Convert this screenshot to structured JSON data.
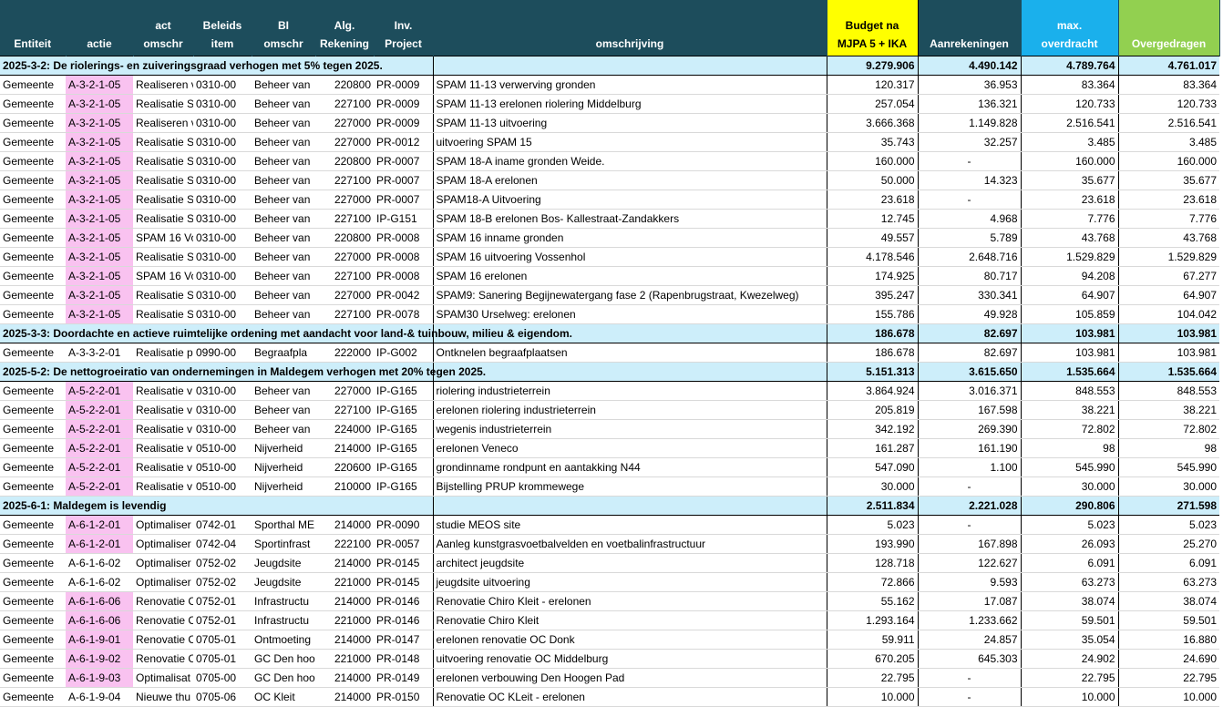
{
  "headers": {
    "entiteit": [
      "",
      "Entiteit"
    ],
    "actie": [
      "",
      "actie"
    ],
    "act_omschr": [
      "act",
      "omschr"
    ],
    "beleids_item": [
      "Beleids",
      "item"
    ],
    "bi_omschr": [
      "BI",
      "omschr"
    ],
    "alg_rekening": [
      "Alg.",
      "Rekening"
    ],
    "inv_project": [
      "Inv.",
      "Project"
    ],
    "omschrijving": [
      "",
      "omschrijving"
    ],
    "budget": [
      "Budget na",
      "MJPA 5 + IKA"
    ],
    "aanrekeningen": [
      "",
      "Aanrekeningen"
    ],
    "max_overdracht": [
      "max.",
      "overdracht"
    ],
    "overgedragen": [
      "",
      "Overgedragen"
    ]
  },
  "groups": [
    {
      "title": "2025-3-2: De riolerings- en zuiveringsgraad verhogen met 5% tegen 2025.",
      "budget": "9.279.906",
      "aanrekeningen": "4.490.142",
      "max_overdracht": "4.789.764",
      "overgedragen": "4.761.017",
      "rows": [
        {
          "entiteit": "Gemeente",
          "actie": "A-3-2-1-05",
          "pink": true,
          "act_omschr": "Realiseren v",
          "beleids_item": "0310-00",
          "bi_omschr": "Beheer van",
          "alg_rekening": "220800",
          "inv_project": "PR-0009",
          "omschrijving": "SPAM 11-13 verwerving gronden",
          "budget": "120.317",
          "aanrekeningen": "36.953",
          "max_overdracht": "83.364",
          "overgedragen": "83.364"
        },
        {
          "entiteit": "Gemeente",
          "actie": "A-3-2-1-05",
          "pink": true,
          "act_omschr": "Realisatie S",
          "beleids_item": "0310-00",
          "bi_omschr": "Beheer van",
          "alg_rekening": "227100",
          "inv_project": "PR-0009",
          "omschrijving": "SPAM 11-13 erelonen riolering Middelburg",
          "budget": "257.054",
          "aanrekeningen": "136.321",
          "max_overdracht": "120.733",
          "overgedragen": "120.733"
        },
        {
          "entiteit": "Gemeente",
          "actie": "A-3-2-1-05",
          "pink": true,
          "act_omschr": "Realiseren v",
          "beleids_item": "0310-00",
          "bi_omschr": "Beheer van",
          "alg_rekening": "227000",
          "inv_project": "PR-0009",
          "omschrijving": "SPAM 11-13 uitvoering",
          "budget": "3.666.368",
          "aanrekeningen": "1.149.828",
          "max_overdracht": "2.516.541",
          "overgedragen": "2.516.541"
        },
        {
          "entiteit": "Gemeente",
          "actie": "A-3-2-1-05",
          "pink": true,
          "act_omschr": "Realisatie S",
          "beleids_item": "0310-00",
          "bi_omschr": "Beheer van",
          "alg_rekening": "227000",
          "inv_project": "PR-0012",
          "omschrijving": "uitvoering SPAM 15",
          "budget": "35.743",
          "aanrekeningen": "32.257",
          "max_overdracht": "3.485",
          "overgedragen": "3.485"
        },
        {
          "entiteit": "Gemeente",
          "actie": "A-3-2-1-05",
          "pink": true,
          "act_omschr": "Realisatie S",
          "beleids_item": "0310-00",
          "bi_omschr": "Beheer van",
          "alg_rekening": "220800",
          "inv_project": "PR-0007",
          "omschrijving": "SPAM 18-A iname gronden Weide.",
          "budget": "160.000",
          "aanrekeningen": "-",
          "max_overdracht": "160.000",
          "overgedragen": "160.000"
        },
        {
          "entiteit": "Gemeente",
          "actie": "A-3-2-1-05",
          "pink": true,
          "act_omschr": "Realisatie S",
          "beleids_item": "0310-00",
          "bi_omschr": "Beheer van",
          "alg_rekening": "227100",
          "inv_project": "PR-0007",
          "omschrijving": "SPAM 18-A erelonen",
          "budget": "50.000",
          "aanrekeningen": "14.323",
          "max_overdracht": "35.677",
          "overgedragen": "35.677"
        },
        {
          "entiteit": "Gemeente",
          "actie": "A-3-2-1-05",
          "pink": true,
          "act_omschr": "Realisatie S",
          "beleids_item": "0310-00",
          "bi_omschr": "Beheer van",
          "alg_rekening": "227000",
          "inv_project": "PR-0007",
          "omschrijving": "SPAM18-A Uitvoering",
          "budget": "23.618",
          "aanrekeningen": "-",
          "max_overdracht": "23.618",
          "overgedragen": "23.618"
        },
        {
          "entiteit": "Gemeente",
          "actie": "A-3-2-1-05",
          "pink": true,
          "act_omschr": "Realisatie S",
          "beleids_item": "0310-00",
          "bi_omschr": "Beheer van",
          "alg_rekening": "227100",
          "inv_project": "IP-G151",
          "omschrijving": "SPAM 18-B erelonen  Bos- Kallestraat-Zandakkers",
          "budget": "12.745",
          "aanrekeningen": "4.968",
          "max_overdracht": "7.776",
          "overgedragen": "7.776"
        },
        {
          "entiteit": "Gemeente",
          "actie": "A-3-2-1-05",
          "pink": true,
          "act_omschr": "SPAM 16 Vo",
          "beleids_item": "0310-00",
          "bi_omschr": "Beheer van",
          "alg_rekening": "220800",
          "inv_project": "PR-0008",
          "omschrijving": "SPAM 16 inname gronden",
          "budget": "49.557",
          "aanrekeningen": "5.789",
          "max_overdracht": "43.768",
          "overgedragen": "43.768"
        },
        {
          "entiteit": "Gemeente",
          "actie": "A-3-2-1-05",
          "pink": true,
          "act_omschr": "Realisatie S",
          "beleids_item": "0310-00",
          "bi_omschr": "Beheer van",
          "alg_rekening": "227000",
          "inv_project": "PR-0008",
          "omschrijving": "SPAM 16 uitvoering Vossenhol",
          "budget": "4.178.546",
          "aanrekeningen": "2.648.716",
          "max_overdracht": "1.529.829",
          "overgedragen": "1.529.829"
        },
        {
          "entiteit": "Gemeente",
          "actie": "A-3-2-1-05",
          "pink": true,
          "act_omschr": "SPAM 16 Vo",
          "beleids_item": "0310-00",
          "bi_omschr": "Beheer van",
          "alg_rekening": "227100",
          "inv_project": "PR-0008",
          "omschrijving": "SPAM 16 erelonen",
          "budget": "174.925",
          "aanrekeningen": "80.717",
          "max_overdracht": "94.208",
          "overgedragen": "67.277"
        },
        {
          "entiteit": "Gemeente",
          "actie": "A-3-2-1-05",
          "pink": true,
          "act_omschr": "Realisatie S",
          "beleids_item": "0310-00",
          "bi_omschr": "Beheer van",
          "alg_rekening": "227000",
          "inv_project": "PR-0042",
          "omschrijving": "SPAM9: Sanering Begijnewatergang fase 2 (Rapenbrugstraat, Kwezelweg)",
          "budget": "395.247",
          "aanrekeningen": "330.341",
          "max_overdracht": "64.907",
          "overgedragen": "64.907"
        },
        {
          "entiteit": "Gemeente",
          "actie": "A-3-2-1-05",
          "pink": true,
          "act_omschr": "Realisatie S",
          "beleids_item": "0310-00",
          "bi_omschr": "Beheer van",
          "alg_rekening": "227100",
          "inv_project": "PR-0078",
          "omschrijving": "SPAM30 Urselweg: erelonen",
          "budget": "155.786",
          "aanrekeningen": "49.928",
          "max_overdracht": "105.859",
          "overgedragen": "104.042"
        }
      ]
    },
    {
      "title": "2025-3-3: Doordachte en actieve ruimtelijke ordening met aandacht voor land-& tuinbouw, milieu & eigendom.",
      "budget": "186.678",
      "aanrekeningen": "82.697",
      "max_overdracht": "103.981",
      "overgedragen": "103.981",
      "rows": [
        {
          "entiteit": "Gemeente",
          "actie": "A-3-3-2-01",
          "pink": false,
          "act_omschr": "Realisatie p",
          "beleids_item": "0990-00",
          "bi_omschr": "Begraafpla",
          "alg_rekening": "222000",
          "inv_project": "IP-G002",
          "omschrijving": "Ontknelen begraafplaatsen",
          "budget": "186.678",
          "aanrekeningen": "82.697",
          "max_overdracht": "103.981",
          "overgedragen": "103.981"
        }
      ]
    },
    {
      "title": "2025-5-2: De nettogroeiratio van ondernemingen in Maldegem verhogen met 20% tegen 2025.",
      "budget": "5.151.313",
      "aanrekeningen": "3.615.650",
      "max_overdracht": "1.535.664",
      "overgedragen": "1.535.664",
      "rows": [
        {
          "entiteit": "Gemeente",
          "actie": "A-5-2-2-01",
          "pink": true,
          "act_omschr": "Realisatie v",
          "beleids_item": "0310-00",
          "bi_omschr": "Beheer van",
          "alg_rekening": "227000",
          "inv_project": "IP-G165",
          "omschrijving": "riolering industrieterrein",
          "budget": "3.864.924",
          "aanrekeningen": "3.016.371",
          "max_overdracht": "848.553",
          "overgedragen": "848.553"
        },
        {
          "entiteit": "Gemeente",
          "actie": "A-5-2-2-01",
          "pink": true,
          "act_omschr": "Realisatie v",
          "beleids_item": "0310-00",
          "bi_omschr": "Beheer van",
          "alg_rekening": "227100",
          "inv_project": "IP-G165",
          "omschrijving": "erelonen riolering industrieterrein",
          "budget": "205.819",
          "aanrekeningen": "167.598",
          "max_overdracht": "38.221",
          "overgedragen": "38.221"
        },
        {
          "entiteit": "Gemeente",
          "actie": "A-5-2-2-01",
          "pink": true,
          "act_omschr": "Realisatie v",
          "beleids_item": "0310-00",
          "bi_omschr": "Beheer van",
          "alg_rekening": "224000",
          "inv_project": "IP-G165",
          "omschrijving": "wegenis industrieterrein",
          "budget": "342.192",
          "aanrekeningen": "269.390",
          "max_overdracht": "72.802",
          "overgedragen": "72.802"
        },
        {
          "entiteit": "Gemeente",
          "actie": "A-5-2-2-01",
          "pink": true,
          "act_omschr": "Realisatie v",
          "beleids_item": "0510-00",
          "bi_omschr": "Nijverheid",
          "alg_rekening": "214000",
          "inv_project": "IP-G165",
          "omschrijving": "erelonen Veneco",
          "budget": "161.287",
          "aanrekeningen": "161.190",
          "max_overdracht": "98",
          "overgedragen": "98"
        },
        {
          "entiteit": "Gemeente",
          "actie": "A-5-2-2-01",
          "pink": true,
          "act_omschr": "Realisatie v",
          "beleids_item": "0510-00",
          "bi_omschr": "Nijverheid",
          "alg_rekening": "220600",
          "inv_project": "IP-G165",
          "omschrijving": "grondinname rondpunt en aantakking N44",
          "budget": "547.090",
          "aanrekeningen": "1.100",
          "max_overdracht": "545.990",
          "overgedragen": "545.990"
        },
        {
          "entiteit": "Gemeente",
          "actie": "A-5-2-2-01",
          "pink": true,
          "act_omschr": "Realisatie v",
          "beleids_item": "0510-00",
          "bi_omschr": "Nijverheid",
          "alg_rekening": "210000",
          "inv_project": "IP-G165",
          "omschrijving": "Bijstelling PRUP krommewege",
          "budget": "30.000",
          "aanrekeningen": "-",
          "max_overdracht": "30.000",
          "overgedragen": "30.000"
        }
      ]
    },
    {
      "title": "2025-6-1: Maldegem is levendig",
      "budget": "2.511.834",
      "aanrekeningen": "2.221.028",
      "max_overdracht": "290.806",
      "overgedragen": "271.598",
      "rows": [
        {
          "entiteit": "Gemeente",
          "actie": "A-6-1-2-01",
          "pink": true,
          "act_omschr": "Optimaliser",
          "beleids_item": "0742-01",
          "bi_omschr": "Sporthal ME",
          "alg_rekening": "214000",
          "inv_project": "PR-0090",
          "omschrijving": "studie MEOS site",
          "budget": "5.023",
          "aanrekeningen": "-",
          "max_overdracht": "5.023",
          "overgedragen": "5.023"
        },
        {
          "entiteit": "Gemeente",
          "actie": "A-6-1-2-01",
          "pink": true,
          "act_omschr": "Optimaliser",
          "beleids_item": "0742-04",
          "bi_omschr": "Sportinfrast",
          "alg_rekening": "222100",
          "inv_project": "PR-0057",
          "omschrijving": "Aanleg kunstgrasvoetbalvelden en voetbalinfrastructuur",
          "budget": "193.990",
          "aanrekeningen": "167.898",
          "max_overdracht": "26.093",
          "overgedragen": "25.270"
        },
        {
          "entiteit": "Gemeente",
          "actie": "A-6-1-6-02",
          "pink": false,
          "act_omschr": "Optimaliser",
          "beleids_item": "0752-02",
          "bi_omschr": "Jeugdsite",
          "alg_rekening": "214000",
          "inv_project": "PR-0145",
          "omschrijving": "architect jeugdsite",
          "budget": "128.718",
          "aanrekeningen": "122.627",
          "max_overdracht": "6.091",
          "overgedragen": "6.091"
        },
        {
          "entiteit": "Gemeente",
          "actie": "A-6-1-6-02",
          "pink": false,
          "act_omschr": "Optimaliser",
          "beleids_item": "0752-02",
          "bi_omschr": "Jeugdsite",
          "alg_rekening": "221000",
          "inv_project": "PR-0145",
          "omschrijving": "jeugdsite uitvoering",
          "budget": "72.866",
          "aanrekeningen": "9.593",
          "max_overdracht": "63.273",
          "overgedragen": "63.273"
        },
        {
          "entiteit": "Gemeente",
          "actie": "A-6-1-6-06",
          "pink": true,
          "act_omschr": "Renovatie C",
          "beleids_item": "0752-01",
          "bi_omschr": "Infrastructu",
          "alg_rekening": "214000",
          "inv_project": "PR-0146",
          "omschrijving": "Renovatie Chiro Kleit - erelonen",
          "budget": "55.162",
          "aanrekeningen": "17.087",
          "max_overdracht": "38.074",
          "overgedragen": "38.074"
        },
        {
          "entiteit": "Gemeente",
          "actie": "A-6-1-6-06",
          "pink": true,
          "act_omschr": "Renovatie C",
          "beleids_item": "0752-01",
          "bi_omschr": "Infrastructu",
          "alg_rekening": "221000",
          "inv_project": "PR-0146",
          "omschrijving": "Renovatie Chiro Kleit",
          "budget": "1.293.164",
          "aanrekeningen": "1.233.662",
          "max_overdracht": "59.501",
          "overgedragen": "59.501"
        },
        {
          "entiteit": "Gemeente",
          "actie": "A-6-1-9-01",
          "pink": true,
          "act_omschr": "Renovatie C",
          "beleids_item": "0705-01",
          "bi_omschr": "Ontmoeting",
          "alg_rekening": "214000",
          "inv_project": "PR-0147",
          "omschrijving": "erelonen renovatie OC Donk",
          "budget": "59.911",
          "aanrekeningen": "24.857",
          "max_overdracht": "35.054",
          "overgedragen": "16.880"
        },
        {
          "entiteit": "Gemeente",
          "actie": "A-6-1-9-02",
          "pink": true,
          "act_omschr": "Renovatie C",
          "beleids_item": "0705-01",
          "bi_omschr": "GC Den hoo",
          "alg_rekening": "221000",
          "inv_project": "PR-0148",
          "omschrijving": "uitvoering renovatie OC Middelburg",
          "budget": "670.205",
          "aanrekeningen": "645.303",
          "max_overdracht": "24.902",
          "overgedragen": "24.690"
        },
        {
          "entiteit": "Gemeente",
          "actie": "A-6-1-9-03",
          "pink": true,
          "act_omschr": "Optimalisat",
          "beleids_item": "0705-00",
          "bi_omschr": "GC Den hoo",
          "alg_rekening": "214000",
          "inv_project": "PR-0149",
          "omschrijving": "erelonen verbouwing Den Hoogen Pad",
          "budget": "22.795",
          "aanrekeningen": "-",
          "max_overdracht": "22.795",
          "overgedragen": "22.795"
        },
        {
          "entiteit": "Gemeente",
          "actie": "A-6-1-9-04",
          "pink": false,
          "act_omschr": "Nieuwe thu",
          "beleids_item": "0705-06",
          "bi_omschr": "OC Kleit",
          "alg_rekening": "214000",
          "inv_project": "PR-0150",
          "omschrijving": "Renovatie OC KLeit - erelonen",
          "budget": "10.000",
          "aanrekeningen": "-",
          "max_overdracht": "10.000",
          "overgedragen": "10.000"
        }
      ]
    }
  ]
}
